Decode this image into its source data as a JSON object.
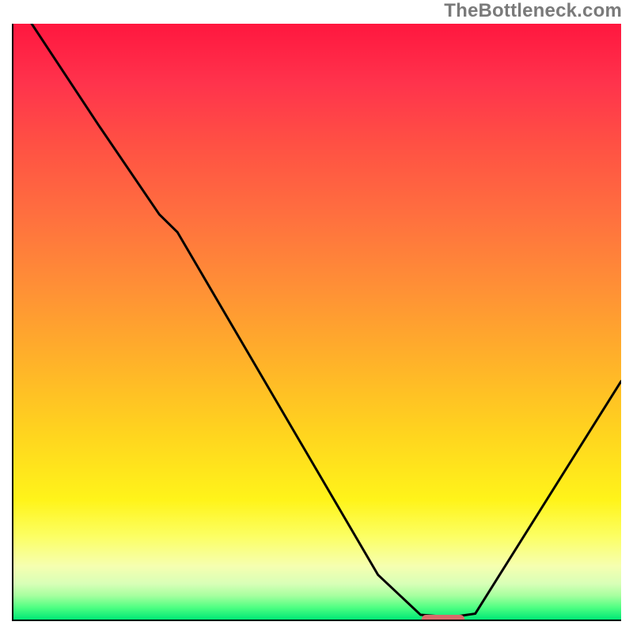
{
  "watermark": "TheBottleneck.com",
  "chart_data": {
    "type": "line",
    "title": "",
    "xlabel": "",
    "ylabel": "",
    "xlim": [
      0,
      100
    ],
    "ylim": [
      0,
      100
    ],
    "grid": false,
    "series": [
      {
        "name": "bottleneck-curve",
        "x": [
          3,
          14,
          24,
          27,
          60,
          67,
          72,
          76,
          100
        ],
        "y": [
          100,
          83,
          68,
          65,
          7.5,
          0.8,
          0.4,
          1,
          40
        ]
      }
    ],
    "annotations": [
      {
        "name": "optimal-marker",
        "x_start": 67,
        "x_end": 74,
        "y": 0.4,
        "color": "#d86a6a"
      }
    ],
    "background_gradient": {
      "stops": [
        {
          "pos": 0.0,
          "color": "#ff173f"
        },
        {
          "pos": 0.5,
          "color": "#ffb02a"
        },
        {
          "pos": 0.8,
          "color": "#fff41a"
        },
        {
          "pos": 0.95,
          "color": "#d8ffb7"
        },
        {
          "pos": 1.0,
          "color": "#00e876"
        }
      ]
    }
  },
  "colors": {
    "curve": "#000000",
    "axis": "#000000",
    "marker": "#d86a6a",
    "watermark": "#7a7a7a"
  }
}
